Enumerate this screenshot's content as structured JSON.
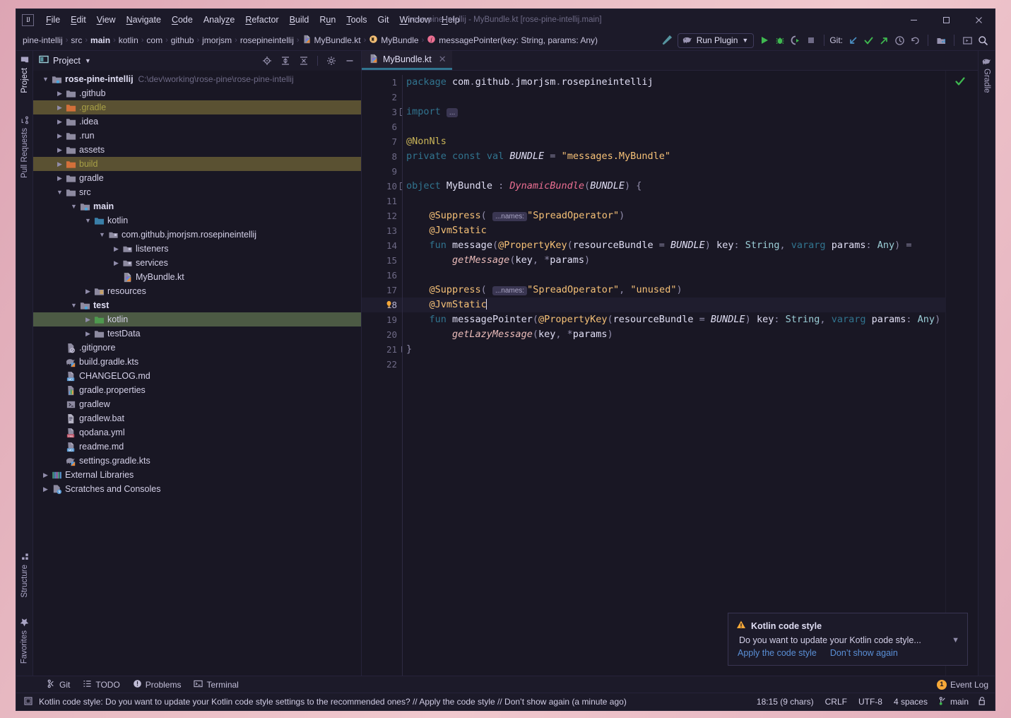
{
  "window": {
    "title": "rose-pine-intellij - MyBundle.kt [rose-pine-intellij.main]",
    "minimize_label": "─",
    "maximize_label": "☐",
    "close_label": "✕"
  },
  "menu": {
    "items": [
      {
        "label": "File",
        "mnemonic": "F"
      },
      {
        "label": "Edit",
        "mnemonic": "E"
      },
      {
        "label": "View",
        "mnemonic": "V"
      },
      {
        "label": "Navigate",
        "mnemonic": "N"
      },
      {
        "label": "Code",
        "mnemonic": "C"
      },
      {
        "label": "Analyze",
        "mnemonic": "z"
      },
      {
        "label": "Refactor",
        "mnemonic": "R"
      },
      {
        "label": "Build",
        "mnemonic": "B"
      },
      {
        "label": "Run",
        "mnemonic": "u"
      },
      {
        "label": "Tools",
        "mnemonic": "T"
      },
      {
        "label": "Git",
        "mnemonic": ""
      },
      {
        "label": "Window",
        "mnemonic": "W"
      },
      {
        "label": "Help",
        "mnemonic": "H"
      }
    ]
  },
  "navbar": {
    "breadcrumbs": [
      {
        "label": "pine-intellij",
        "icon": "",
        "bold": false
      },
      {
        "label": "src",
        "icon": "",
        "bold": false
      },
      {
        "label": "main",
        "icon": "",
        "bold": true
      },
      {
        "label": "kotlin",
        "icon": "",
        "bold": false
      },
      {
        "label": "com",
        "icon": "",
        "bold": false
      },
      {
        "label": "github",
        "icon": "",
        "bold": false
      },
      {
        "label": "jmorjsm",
        "icon": "",
        "bold": false
      },
      {
        "label": "rosepineintellij",
        "icon": "",
        "bold": false
      },
      {
        "label": "MyBundle.kt",
        "icon": "kotlin-file-icon",
        "bold": false
      },
      {
        "label": "MyBundle",
        "icon": "kotlin-object-icon",
        "bold": false
      },
      {
        "label": "messagePointer(key: String, params: Any)",
        "icon": "function-icon",
        "bold": false
      }
    ],
    "separator": "›",
    "run_config": "Run Plugin",
    "git_label": "Git:",
    "toolbar_icons": [
      "build-hammer-icon",
      "run-icon",
      "debug-icon",
      "run-coverage-icon",
      "stop-icon",
      "update-project-icon",
      "commit-icon",
      "push-icon",
      "history-icon",
      "rollback-icon",
      "project-structure-icon",
      "select-run-target-icon",
      "search-everywhere-icon"
    ]
  },
  "left_stripe": {
    "tabs": [
      {
        "label": "Project",
        "icon": "project-folder-icon",
        "active": true
      },
      {
        "label": "Pull Requests",
        "icon": "pull-request-icon",
        "active": false
      }
    ],
    "bottom_tabs": [
      {
        "label": "Structure",
        "icon": "structure-icon",
        "active": false
      },
      {
        "label": "Favorites",
        "icon": "star-icon",
        "active": false
      }
    ]
  },
  "right_stripe": {
    "tabs": [
      {
        "label": "Gradle",
        "icon": "gradle-elephant-icon",
        "active": false
      }
    ]
  },
  "project_panel": {
    "title": "Project",
    "header_icons": [
      "locate-file-icon",
      "expand-all-icon",
      "collapse-all-icon",
      "settings-gear-icon",
      "hide-panel-icon"
    ],
    "tree": [
      {
        "depth": 0,
        "arrow": "down",
        "icon": "module-folder-icon",
        "label": "rose-pine-intellij",
        "bold": true,
        "path": "C:\\dev\\working\\rose-pine\\rose-pine-intellij",
        "state": "normal"
      },
      {
        "depth": 1,
        "arrow": "right",
        "icon": "folder-icon",
        "label": ".github",
        "bold": false,
        "path": "",
        "state": "normal"
      },
      {
        "depth": 1,
        "arrow": "right",
        "icon": "excluded-folder-icon",
        "label": ".gradle",
        "bold": false,
        "path": "",
        "state": "olive"
      },
      {
        "depth": 1,
        "arrow": "right",
        "icon": "folder-icon",
        "label": ".idea",
        "bold": false,
        "path": "",
        "state": "normal"
      },
      {
        "depth": 1,
        "arrow": "right",
        "icon": "folder-icon",
        "label": ".run",
        "bold": false,
        "path": "",
        "state": "normal"
      },
      {
        "depth": 1,
        "arrow": "right",
        "icon": "folder-icon",
        "label": "assets",
        "bold": false,
        "path": "",
        "state": "normal"
      },
      {
        "depth": 1,
        "arrow": "right",
        "icon": "excluded-folder-icon",
        "label": "build",
        "bold": false,
        "path": "",
        "state": "olive"
      },
      {
        "depth": 1,
        "arrow": "right",
        "icon": "folder-icon",
        "label": "gradle",
        "bold": false,
        "path": "",
        "state": "normal"
      },
      {
        "depth": 1,
        "arrow": "down",
        "icon": "folder-icon",
        "label": "src",
        "bold": false,
        "path": "",
        "state": "normal"
      },
      {
        "depth": 2,
        "arrow": "down",
        "icon": "module-folder-icon",
        "label": "main",
        "bold": true,
        "path": "",
        "state": "normal"
      },
      {
        "depth": 3,
        "arrow": "down",
        "icon": "source-root-icon",
        "label": "kotlin",
        "bold": false,
        "path": "",
        "state": "normal"
      },
      {
        "depth": 4,
        "arrow": "down",
        "icon": "package-icon",
        "label": "com.github.jmorjsm.rosepineintellij",
        "bold": false,
        "path": "",
        "state": "normal"
      },
      {
        "depth": 5,
        "arrow": "right",
        "icon": "package-icon",
        "label": "listeners",
        "bold": false,
        "path": "",
        "state": "normal"
      },
      {
        "depth": 5,
        "arrow": "right",
        "icon": "package-icon",
        "label": "services",
        "bold": false,
        "path": "",
        "state": "normal"
      },
      {
        "depth": 5,
        "arrow": "none",
        "icon": "kotlin-file-icon",
        "label": "MyBundle.kt",
        "bold": false,
        "path": "",
        "state": "normal"
      },
      {
        "depth": 3,
        "arrow": "right",
        "icon": "resource-root-icon",
        "label": "resources",
        "bold": false,
        "path": "",
        "state": "normal"
      },
      {
        "depth": 2,
        "arrow": "down",
        "icon": "module-folder-icon",
        "label": "test",
        "bold": true,
        "path": "",
        "state": "normal"
      },
      {
        "depth": 3,
        "arrow": "right",
        "icon": "test-root-icon",
        "label": "kotlin",
        "bold": false,
        "path": "",
        "state": "green"
      },
      {
        "depth": 3,
        "arrow": "right",
        "icon": "folder-icon",
        "label": "testData",
        "bold": false,
        "path": "",
        "state": "normal"
      },
      {
        "depth": 1,
        "arrow": "none",
        "icon": "gitignore-icon",
        "label": ".gitignore",
        "bold": false,
        "path": "",
        "state": "normal"
      },
      {
        "depth": 1,
        "arrow": "none",
        "icon": "gradle-file-icon",
        "label": "build.gradle.kts",
        "bold": false,
        "path": "",
        "state": "normal"
      },
      {
        "depth": 1,
        "arrow": "none",
        "icon": "markdown-icon",
        "label": "CHANGELOG.md",
        "bold": false,
        "path": "",
        "state": "normal"
      },
      {
        "depth": 1,
        "arrow": "none",
        "icon": "properties-icon",
        "label": "gradle.properties",
        "bold": false,
        "path": "",
        "state": "normal"
      },
      {
        "depth": 1,
        "arrow": "none",
        "icon": "shell-script-icon",
        "label": "gradlew",
        "bold": false,
        "path": "",
        "state": "normal"
      },
      {
        "depth": 1,
        "arrow": "none",
        "icon": "bat-file-icon",
        "label": "gradlew.bat",
        "bold": false,
        "path": "",
        "state": "normal"
      },
      {
        "depth": 1,
        "arrow": "none",
        "icon": "yaml-icon",
        "label": "qodana.yml",
        "bold": false,
        "path": "",
        "state": "normal"
      },
      {
        "depth": 1,
        "arrow": "none",
        "icon": "markdown-icon",
        "label": "readme.md",
        "bold": false,
        "path": "",
        "state": "normal"
      },
      {
        "depth": 1,
        "arrow": "none",
        "icon": "gradle-file-icon",
        "label": "settings.gradle.kts",
        "bold": false,
        "path": "",
        "state": "normal"
      },
      {
        "depth": 0,
        "arrow": "right",
        "icon": "libraries-icon",
        "label": "External Libraries",
        "bold": false,
        "path": "",
        "state": "normal"
      },
      {
        "depth": 0,
        "arrow": "right",
        "icon": "scratches-icon",
        "label": "Scratches and Consoles",
        "bold": false,
        "path": "",
        "state": "normal"
      }
    ]
  },
  "editor": {
    "tab": {
      "label": "MyBundle.kt",
      "icon": "kotlin-file-icon",
      "close": "✕",
      "active": true
    },
    "inspection_status": "ok",
    "current_line": 18,
    "line_numbers": [
      1,
      2,
      3,
      6,
      7,
      8,
      9,
      10,
      11,
      12,
      13,
      14,
      15,
      16,
      17,
      18,
      19,
      20,
      21,
      22
    ],
    "lines": [
      "package com.github.jmorjsm.rosepineintellij",
      "",
      "import ...",
      "",
      "@NonNls",
      "private const val BUNDLE = \"messages.MyBundle\"",
      "",
      "object MyBundle : DynamicBundle(BUNDLE) {",
      "",
      "    @Suppress( ...names: \"SpreadOperator\")",
      "    @JvmStatic",
      "    fun message(@PropertyKey(resourceBundle = BUNDLE) key: String, vararg params: Any) =",
      "        getMessage(key, *params)",
      "",
      "    @Suppress( ...names: \"SpreadOperator\", \"unused\")",
      "    @JvmStatic",
      "    fun messagePointer(@PropertyKey(resourceBundle = BUNDLE) key: String, vararg params: Any) =",
      "        getLazyMessage(key, *params)",
      "}",
      ""
    ],
    "inlay_hint": "...names:",
    "import_fold": "..."
  },
  "notification": {
    "title": "Kotlin code style",
    "icon": "warning-triangle-icon",
    "body": "Do you want to update your Kotlin code style...",
    "chevron": "⌄",
    "actions": [
      {
        "label": "Apply the code style"
      },
      {
        "label": "Don’t show again"
      }
    ]
  },
  "bottom_stripe": {
    "tabs": [
      {
        "label": "Git",
        "icon": "git-branch-icon"
      },
      {
        "label": "TODO",
        "icon": "todo-list-icon"
      },
      {
        "label": "Problems",
        "icon": "problems-icon"
      },
      {
        "label": "Terminal",
        "icon": "terminal-icon"
      }
    ],
    "event_log": {
      "label": "Event Log",
      "count": "1",
      "icon": "event-log-badge-icon"
    }
  },
  "status_bar": {
    "message": "Kotlin code style: Do you want to update your Kotlin code style settings to the recommended ones? // Apply the code style // Don’t show again (a minute ago)",
    "message_icon": "notification-balloon-icon",
    "caret_position": "18:15 (9 chars)",
    "line_separator": "CRLF",
    "encoding": "UTF-8",
    "indent": "4 spaces",
    "branch": "main",
    "branch_icon": "git-branch-icon",
    "lock_icon": "read-write-lock-icon"
  },
  "colors": {
    "accent_teal": "#31748f",
    "editor_bg": "#191724",
    "panel_bg": "#1c1a29",
    "string": "#f6c177",
    "keyword": "#31748f",
    "class": "#eb6f92",
    "function": "#ebbcba",
    "type": "#9ccfd8",
    "selection_olive": "#5a5132",
    "selection_green": "#4c5a44",
    "warning": "#f6a838",
    "link": "#5a8fd6"
  }
}
